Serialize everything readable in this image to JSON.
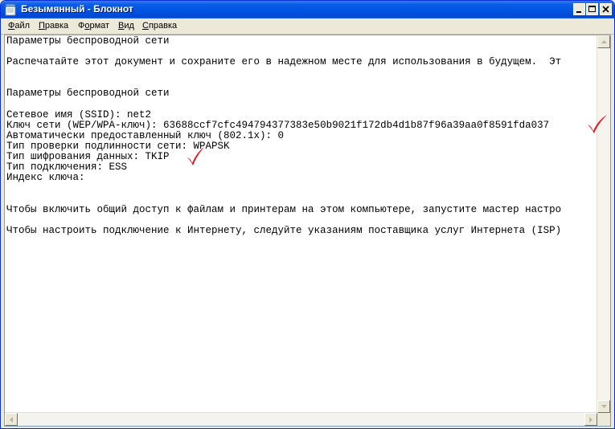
{
  "window": {
    "title": "Безымянный - Блокнот",
    "icon": "notepad-icon",
    "controls": [
      "minimize-icon",
      "maximize-icon",
      "close-icon"
    ]
  },
  "menu": [
    {
      "hotkey": "Ф",
      "rest": "айл"
    },
    {
      "hotkey": "П",
      "rest": "равка"
    },
    {
      "hotkey": "",
      "rest": "Ф",
      "tail": "ормат",
      "hotkey_index": 1
    },
    {
      "hotkey": "В",
      "rest": "ид"
    },
    {
      "hotkey": "С",
      "rest": "правка"
    }
  ],
  "menu_labels": {
    "file_hot": "Ф",
    "file_rest": "айл",
    "edit_hot": "П",
    "edit_rest": "равка",
    "format_pre": "Ф",
    "format_hot": "о",
    "format_rest": "рмат",
    "view_hot": "В",
    "view_rest": "ид",
    "help_hot": "С",
    "help_rest": "правка"
  },
  "document": {
    "lines": [
      "Параметры беспроводной сети",
      "",
      "Распечатайте этот документ и сохраните его в надежном месте для использования в будущем.  Эт",
      "",
      "",
      "Параметры беспроводной сети",
      "",
      "Сетевое имя (SSID): net2",
      "Ключ сети (WEP/WPA-ключ): 63688ccf7cfc494794377383e50b9021f172db4d1b87f96a39aa0f8591fda037",
      "Автоматически предоставленный ключ (802.1x): 0",
      "Тип проверки подлинности сети: WPAPSK",
      "Тип шифрования данных: TKIP",
      "Тип подключения: ESS",
      "Индекс ключа:",
      "",
      "",
      "Чтобы включить общий доступ к файлам и принтерам на этом компьютере, запустите мастер настро",
      "",
      "Чтобы настроить подключение к Интернету, следуйте указаниям поставщика услуг Интернета (ISP)"
    ]
  },
  "annotations": {
    "checkmark_color": "#e8101a",
    "marks": [
      "checkmark-icon",
      "checkmark-icon"
    ]
  },
  "colors": {
    "titlebar": "#0054e3",
    "close_button": "#ffffff",
    "editor_bg": "#ffffff"
  }
}
